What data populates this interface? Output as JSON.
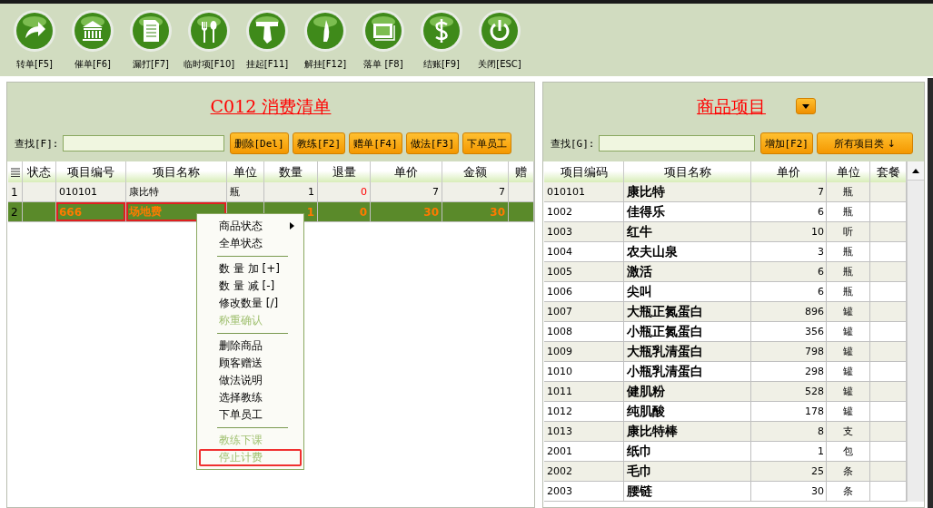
{
  "toolbar": [
    {
      "label": "转单[F5]",
      "kind": "arrow"
    },
    {
      "label": "催单[F6]",
      "kind": "columns"
    },
    {
      "label": "漏打[F7]",
      "kind": "document"
    },
    {
      "label": "临时项[F10]",
      "kind": "utensils"
    },
    {
      "label": "挂起[F11]",
      "kind": "hang"
    },
    {
      "label": "解挂[F12]",
      "kind": "leaf"
    },
    {
      "label": "落单 [F8]",
      "kind": "tray"
    },
    {
      "label": "结账[F9]",
      "kind": "dollar"
    },
    {
      "label": "关闭[ESC]",
      "kind": "power"
    }
  ],
  "order": {
    "title": "C012  消费清单",
    "search_label": "查找[F]:",
    "buttons": [
      "删除[Del]",
      "教练[F2]",
      "赠单[F4]",
      "做法[F3]",
      "下单员工"
    ],
    "columns": [
      "状态",
      "项目编号",
      "项目名称",
      "单位",
      "数量",
      "退量",
      "单价",
      "金额",
      "赠"
    ],
    "rows": [
      {
        "index": "1",
        "selected": false,
        "cells": [
          {
            "text": "",
            "outlined": false
          },
          {
            "text": "010101",
            "outlined": false
          },
          {
            "text": "康比特",
            "outlined": false
          },
          {
            "text": "瓶",
            "outlined": false
          },
          {
            "text": "1",
            "outlined": false
          },
          {
            "text": "0",
            "outlined": false
          },
          {
            "text": "7",
            "outlined": false
          },
          {
            "text": "7",
            "outlined": false
          },
          {
            "text": "",
            "outlined": false
          }
        ]
      },
      {
        "index": "2",
        "selected": true,
        "cells": [
          {
            "text": "",
            "outlined": false
          },
          {
            "text": "666",
            "outlined": true
          },
          {
            "text": "场地费",
            "outlined": true
          },
          {
            "text": "",
            "outlined": false
          },
          {
            "text": "1",
            "outlined": false
          },
          {
            "text": "0",
            "outlined": false
          },
          {
            "text": "30",
            "outlined": false
          },
          {
            "text": "30",
            "outlined": false
          },
          {
            "text": "",
            "outlined": false
          }
        ]
      }
    ]
  },
  "context_menu": {
    "groups": [
      [
        {
          "label": "商品状态",
          "submenu": true,
          "disabled": false,
          "outlined": false
        },
        {
          "label": "全单状态",
          "submenu": false,
          "disabled": false,
          "outlined": false
        }
      ],
      [
        {
          "label": "数 量 加 [+]",
          "submenu": false,
          "disabled": false,
          "outlined": false
        },
        {
          "label": "数 量 减 [-]",
          "submenu": false,
          "disabled": false,
          "outlined": false
        },
        {
          "label": "修改数量 [/]",
          "submenu": false,
          "disabled": false,
          "outlined": false
        },
        {
          "label": "称重确认",
          "submenu": false,
          "disabled": true,
          "outlined": false
        }
      ],
      [
        {
          "label": "删除商品",
          "submenu": false,
          "disabled": false,
          "outlined": false
        },
        {
          "label": "顾客赠送",
          "submenu": false,
          "disabled": false,
          "outlined": false
        },
        {
          "label": "做法说明",
          "submenu": false,
          "disabled": false,
          "outlined": false
        },
        {
          "label": "选择教练",
          "submenu": false,
          "disabled": false,
          "outlined": false
        },
        {
          "label": "下单员工",
          "submenu": false,
          "disabled": false,
          "outlined": false
        }
      ],
      [
        {
          "label": "教练下课",
          "submenu": false,
          "disabled": true,
          "outlined": false
        },
        {
          "label": "停止计费",
          "submenu": false,
          "disabled": true,
          "outlined": true
        }
      ]
    ]
  },
  "products": {
    "title": "商品项目",
    "search_label": "查找[G]:",
    "buttons": [
      "增加[F2]",
      "所有项目类 ↓"
    ],
    "columns": [
      "项目编码",
      "项目名称",
      "单价",
      "单位",
      "套餐"
    ],
    "rows": [
      [
        "010101",
        "康比特",
        "7",
        "瓶",
        ""
      ],
      [
        "1002",
        "佳得乐",
        "6",
        "瓶",
        ""
      ],
      [
        "1003",
        "红牛",
        "10",
        "听",
        ""
      ],
      [
        "1004",
        "农夫山泉",
        "3",
        "瓶",
        ""
      ],
      [
        "1005",
        "激活",
        "6",
        "瓶",
        ""
      ],
      [
        "1006",
        "尖叫",
        "6",
        "瓶",
        ""
      ],
      [
        "1007",
        "大瓶正氮蛋白",
        "896",
        "罐",
        ""
      ],
      [
        "1008",
        "小瓶正氮蛋白",
        "356",
        "罐",
        ""
      ],
      [
        "1009",
        "大瓶乳清蛋白",
        "798",
        "罐",
        ""
      ],
      [
        "1010",
        "小瓶乳清蛋白",
        "298",
        "罐",
        ""
      ],
      [
        "1011",
        "健肌粉",
        "528",
        "罐",
        ""
      ],
      [
        "1012",
        "纯肌酸",
        "178",
        "罐",
        ""
      ],
      [
        "1013",
        "康比特棒",
        "8",
        "支",
        ""
      ],
      [
        "2001",
        "纸巾",
        "1",
        "包",
        ""
      ],
      [
        "2002",
        "毛巾",
        "25",
        "条",
        ""
      ],
      [
        "2003",
        "腰链",
        "30",
        "条",
        ""
      ]
    ]
  }
}
